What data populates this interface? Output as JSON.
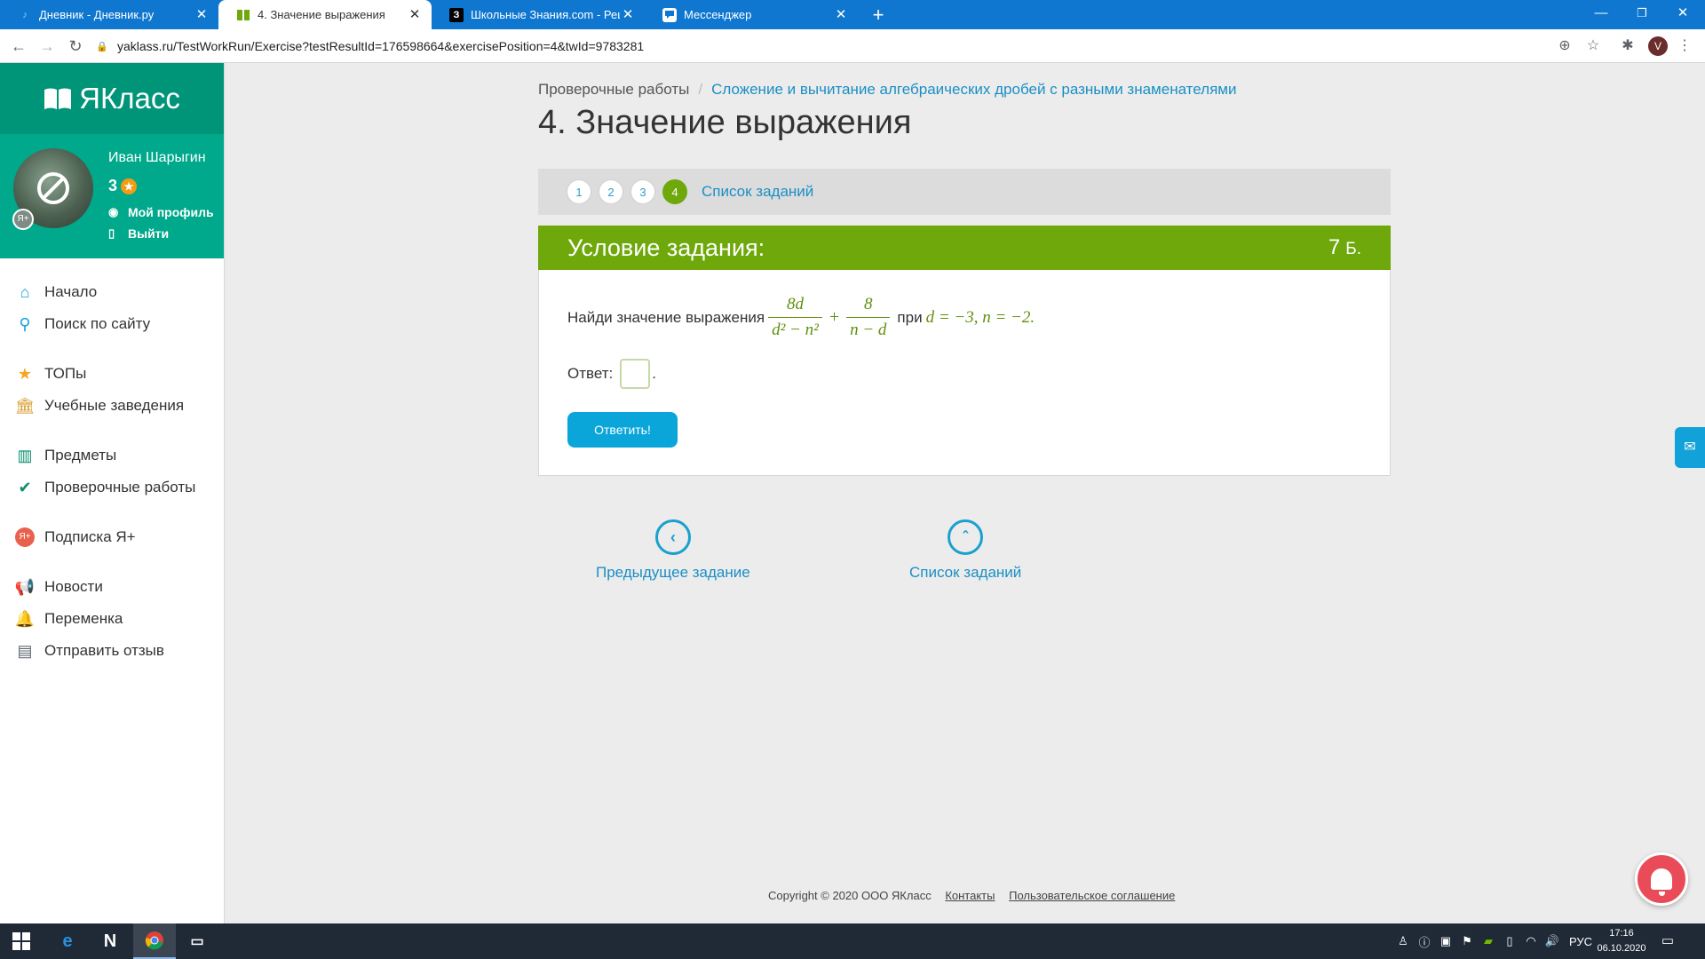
{
  "browser": {
    "tabs": [
      {
        "title": "Дневник - Дневник.ру",
        "favicon": "dnevnik-icon"
      },
      {
        "title": "4. Значение выражения",
        "favicon": "yaklass-icon"
      },
      {
        "title": "Школьные Знания.com - Решае",
        "favicon": "znanija-icon",
        "favicon_text": "З"
      },
      {
        "title": "Мессенджер",
        "favicon": "messenger-icon"
      }
    ],
    "url": "yaklass.ru/TestWorkRun/Exercise?testResultId=176598664&exercisePosition=4&twId=9783281",
    "profile_initial": "V"
  },
  "sidebar": {
    "logo_text": "ЯКласс",
    "user": {
      "name": "Иван Шарыгин",
      "points": "3",
      "badge": "Я+",
      "profile_link": "Мой профиль",
      "logout_link": "Выйти"
    },
    "menu": [
      {
        "label": "Начало",
        "icon": "home-icon"
      },
      {
        "label": "Поиск по сайту",
        "icon": "search-icon"
      },
      {
        "label": "ТОПы",
        "icon": "star-icon"
      },
      {
        "label": "Учебные заведения",
        "icon": "school-icon"
      },
      {
        "label": "Предметы",
        "icon": "books-icon"
      },
      {
        "label": "Проверочные работы",
        "icon": "check-circle-icon"
      },
      {
        "label": "Подписка Я+",
        "icon": "ya-plus-icon"
      },
      {
        "label": "Новости",
        "icon": "megaphone-icon"
      },
      {
        "label": "Переменка",
        "icon": "bell-icon"
      },
      {
        "label": "Отправить отзыв",
        "icon": "feedback-icon"
      }
    ]
  },
  "main": {
    "breadcrumb": {
      "root": "Проверочные работы",
      "separator": "/",
      "current": "Сложение и вычитание алгебраических дробей с разными знаменателями"
    },
    "title": "4. Значение выражения",
    "pager": {
      "pages": [
        "1",
        "2",
        "3",
        "4"
      ],
      "current": "4",
      "list_link": "Список заданий"
    },
    "task": {
      "header": "Условие задания:",
      "points": "7",
      "points_unit": "Б.",
      "prompt": "Найди значение выражения",
      "fraction1": {
        "numerator": "8d",
        "denominator": "d² − n²"
      },
      "operator": "+",
      "fraction2": {
        "numerator": "8",
        "denominator": "n − d"
      },
      "condition_word": "при",
      "condition": "d = −3, n = −2.",
      "answer_label": "Ответ:",
      "answer_value": "",
      "answer_suffix": ".",
      "submit_label": "Ответить!"
    },
    "nav": {
      "prev_label": "Предыдущее задание",
      "list_label": "Список заданий"
    }
  },
  "footer": {
    "copyright": "Copyright © 2020 ООО ЯКласс",
    "contacts": "Контакты",
    "agreement": "Пользовательское соглашение"
  },
  "taskbar": {
    "lang": "РУС",
    "time": "17:16",
    "date": "06.10.2020"
  },
  "colors": {
    "brand_green": "#009479",
    "accent_green": "#6ea80b",
    "link_blue": "#1a8fc4",
    "button_blue": "#0aa5d9",
    "bell_red": "#e94b58"
  }
}
